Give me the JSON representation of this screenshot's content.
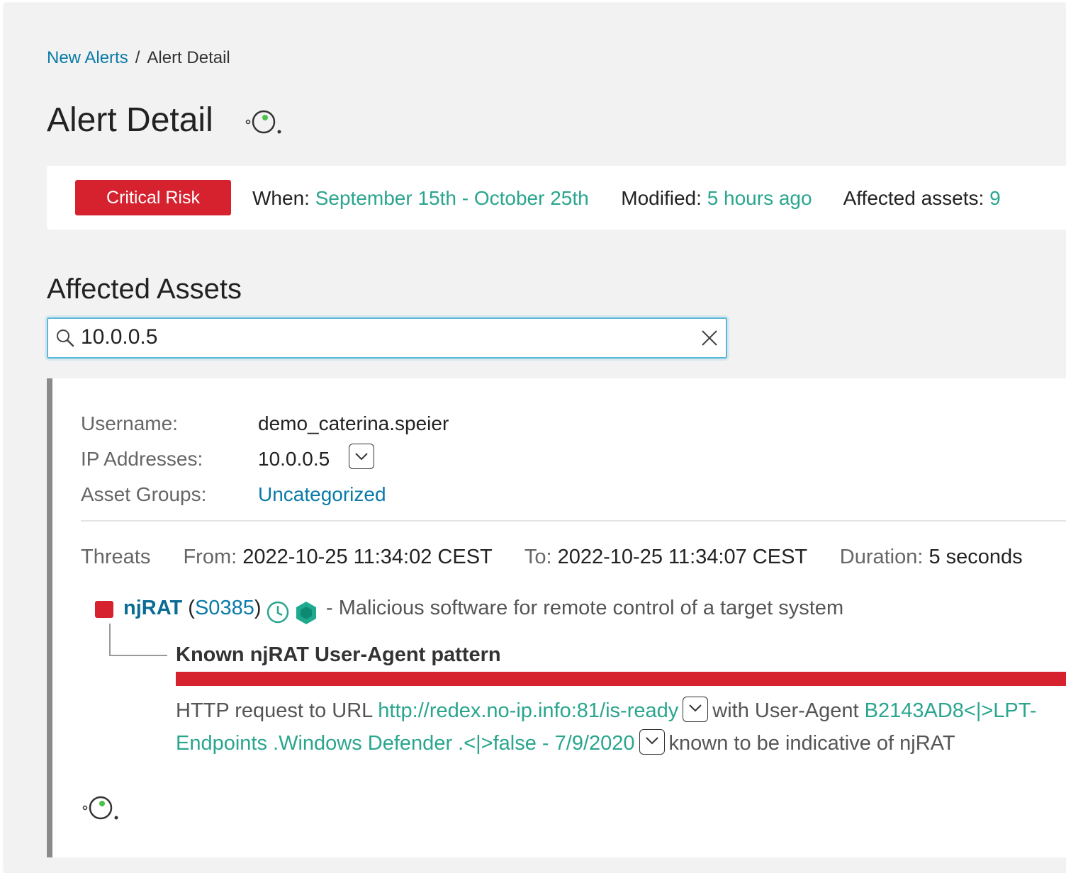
{
  "breadcrumb": {
    "parent": "New Alerts",
    "separator": "/",
    "current": "Alert Detail"
  },
  "page": {
    "title": "Alert Detail",
    "logo_icon": "stealthwatch-logo-icon"
  },
  "summary": {
    "risk_label": "Critical Risk",
    "risk_color": "#d6212e",
    "when_label": "When:",
    "when_value": "September 15th - October 25th",
    "modified_label": "Modified:",
    "modified_value": "5 hours ago",
    "affected_label": "Affected assets:",
    "affected_value": "9",
    "accent_color": "#2aa58e"
  },
  "assets": {
    "section_title": "Affected Assets",
    "search": {
      "value": "10.0.0.5",
      "icon": "search-icon",
      "clear_icon": "close-icon"
    }
  },
  "asset": {
    "username_label": "Username:",
    "username": "demo_caterina.speier",
    "ip_label": "IP Addresses:",
    "ip": "10.0.0.5",
    "groups_label": "Asset Groups:",
    "group": "Uncategorized"
  },
  "threats": {
    "label": "Threats",
    "from_label": "From:",
    "from": "2022-10-25 11:34:02 CEST",
    "to_label": "To:",
    "to": "2022-10-25 11:34:07 CEST",
    "duration_label": "Duration:",
    "duration": "5 seconds",
    "items": [
      {
        "name": "njRAT",
        "open_paren": "(",
        "code": "S0385",
        "close_paren": ")",
        "description": "- Malicious software for remote control of a target system",
        "icons": [
          "clock-icon",
          "hexagon-icon"
        ],
        "severity_color": "#d6212e",
        "detection": {
          "title": "Known njRAT User-Agent pattern",
          "text_1": "HTTP request to URL",
          "url": "http://redex.no-ip.info:81/is-ready",
          "text_2": "with User-Agent",
          "user_agent_line1": "B2143AD8<|>LPT-",
          "user_agent_line2": "Endpoints .Windows Defender .<|>false - 7/9/2020",
          "text_3": "known to be indicative of njRAT"
        }
      }
    ]
  }
}
